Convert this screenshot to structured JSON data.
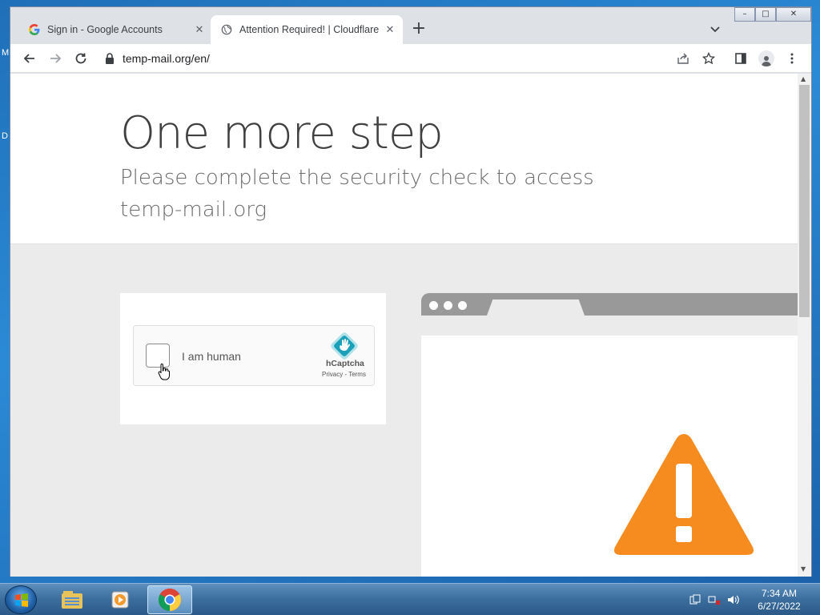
{
  "desktop": {
    "letters": [
      "M",
      "D"
    ]
  },
  "browser": {
    "tabs": [
      {
        "title": "Sign in - Google Accounts",
        "favicon": "google-g-icon",
        "active": false
      },
      {
        "title": "Attention Required! | Cloudflare",
        "favicon": "globe-icon",
        "active": true
      }
    ],
    "window_controls": {
      "minimize": "–",
      "maximize": "□",
      "close": "✕"
    },
    "url": "temp-mail.org/en/"
  },
  "page": {
    "heading": "One more step",
    "subheading": "Please complete the security check to access temp-mail.org",
    "captcha": {
      "label": "I am human",
      "brand": "hCaptcha",
      "links": "Privacy - Terms"
    }
  },
  "colors": {
    "warning": "#f68b1f",
    "illustration_bar": "#999999"
  },
  "taskbar": {
    "apps": [
      "windows-explorer-icon",
      "media-player-icon",
      "chrome-icon"
    ],
    "clock_time": "7:34 AM",
    "clock_date": "6/27/2022"
  }
}
